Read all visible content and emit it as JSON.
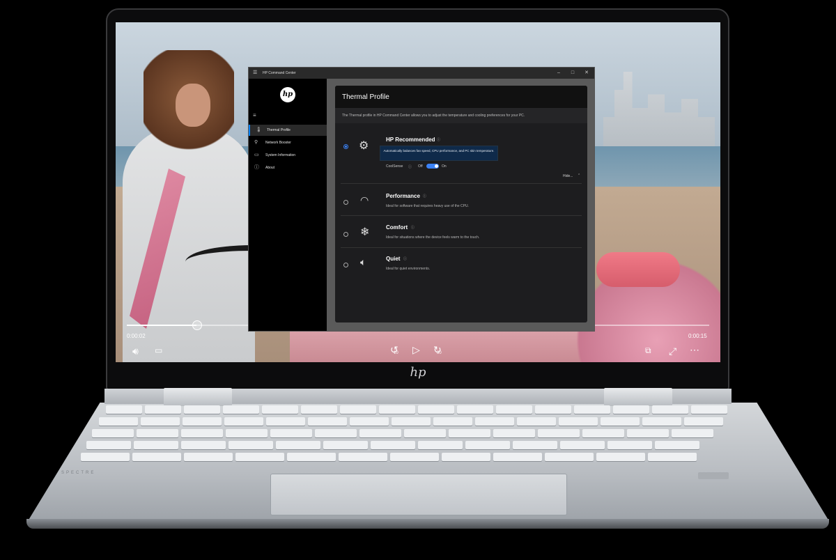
{
  "laptop": {
    "chin_logo": "hp",
    "deck_brand": "SPECTRE"
  },
  "video": {
    "elapsed": "0:00:02",
    "remaining": "0:00:15",
    "progress": 0.12,
    "skip_back_label": "10",
    "skip_forward_label": "30"
  },
  "window": {
    "title": "HP Command Center",
    "logo": "hp",
    "nav": [
      {
        "label": "Thermal Profile",
        "icon": "thermometer-icon",
        "selected": true
      },
      {
        "label": "Network Booster",
        "icon": "network-icon",
        "selected": false
      },
      {
        "label": "System Information",
        "icon": "monitor-icon",
        "selected": false
      },
      {
        "label": "About",
        "icon": "info-icon",
        "selected": false
      }
    ],
    "panel": {
      "title": "Thermal Profile",
      "description": "The Thermal profile in HP Command Center allows you to adjust the temperature and cooling preferences for your PC.",
      "options": [
        {
          "title": "HP Recommended",
          "icon": "gear-icon",
          "selected": true,
          "tooltip": "Automatically balances fan speed, CPU performance, and PC skin temperature.",
          "coolsense_label": "CoolSense",
          "toggle_off": "Off",
          "toggle_on": "On",
          "hide_label": "Hide..."
        },
        {
          "title": "Performance",
          "icon": "speedometer-icon",
          "selected": false,
          "desc": "Ideal for software that requires heavy use of the CPU."
        },
        {
          "title": "Comfort",
          "icon": "snowflake-icon",
          "selected": false,
          "desc": "Ideal for situations where the device feels warm to the touch."
        },
        {
          "title": "Quiet",
          "icon": "speaker-icon",
          "selected": false,
          "desc": "Ideal for quiet environments."
        }
      ]
    }
  },
  "colors": {
    "accent": "#3b82f6",
    "selected_nav": "#2a2a2a"
  }
}
